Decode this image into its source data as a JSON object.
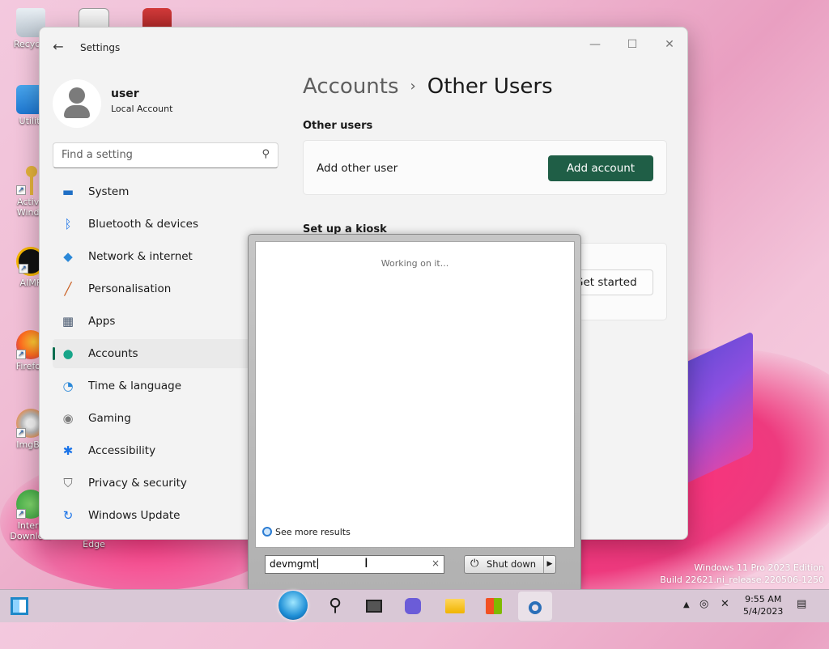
{
  "desktop": {
    "icons": [
      "Recycle",
      "Utiliti",
      "Activa Windo",
      "AIMP",
      "Firefox",
      "ImgBu",
      "Intern Downlo..."
    ],
    "edge_label": "Edge",
    "watermark_line1": "Windows 11 Pro 2023 Edition",
    "watermark_line2": "Build 22621.ni_release.220506-1250"
  },
  "settings": {
    "title": "Settings",
    "user_name": "user",
    "user_type": "Local Account",
    "search_placeholder": "Find a setting",
    "nav": [
      {
        "label": "System",
        "icon": "monitor-icon",
        "color": "#1f6fc5",
        "active": false
      },
      {
        "label": "Bluetooth & devices",
        "icon": "bluetooth-icon",
        "color": "#1a73e8",
        "active": false
      },
      {
        "label": "Network & internet",
        "icon": "wifi-icon",
        "color": "#2b88d8",
        "active": false
      },
      {
        "label": "Personalisation",
        "icon": "brush-icon",
        "color": "#c85a1a",
        "active": false
      },
      {
        "label": "Apps",
        "icon": "apps-icon",
        "color": "#4a5a70",
        "active": false
      },
      {
        "label": "Accounts",
        "icon": "person-icon",
        "color": "#17a589",
        "active": true
      },
      {
        "label": "Time & language",
        "icon": "globe-clock-icon",
        "color": "#2b88d8",
        "active": false
      },
      {
        "label": "Gaming",
        "icon": "gamepad-icon",
        "color": "#7a7a7a",
        "active": false
      },
      {
        "label": "Accessibility",
        "icon": "accessibility-icon",
        "color": "#1a73e8",
        "active": false
      },
      {
        "label": "Privacy & security",
        "icon": "shield-icon",
        "color": "#6d6d6d",
        "active": false
      },
      {
        "label": "Windows Update",
        "icon": "refresh-icon",
        "color": "#1a73e8",
        "active": false
      }
    ],
    "breadcrumb_parent": "Accounts",
    "breadcrumb_sep": "›",
    "breadcrumb_current": "Other Users",
    "other_users_heading": "Other users",
    "add_other_user_label": "Add other user",
    "add_account_button": "Add account",
    "kiosk_heading": "Set up a kiosk",
    "get_started_button": "Get started"
  },
  "startmenu": {
    "status": "Working on it...",
    "see_more": "See more results",
    "search_value": "devmgmt",
    "clear_glyph": "×",
    "shutdown_label": "Shut down"
  },
  "taskbar": {
    "time": "9:55 AM",
    "date": "5/4/2023"
  }
}
